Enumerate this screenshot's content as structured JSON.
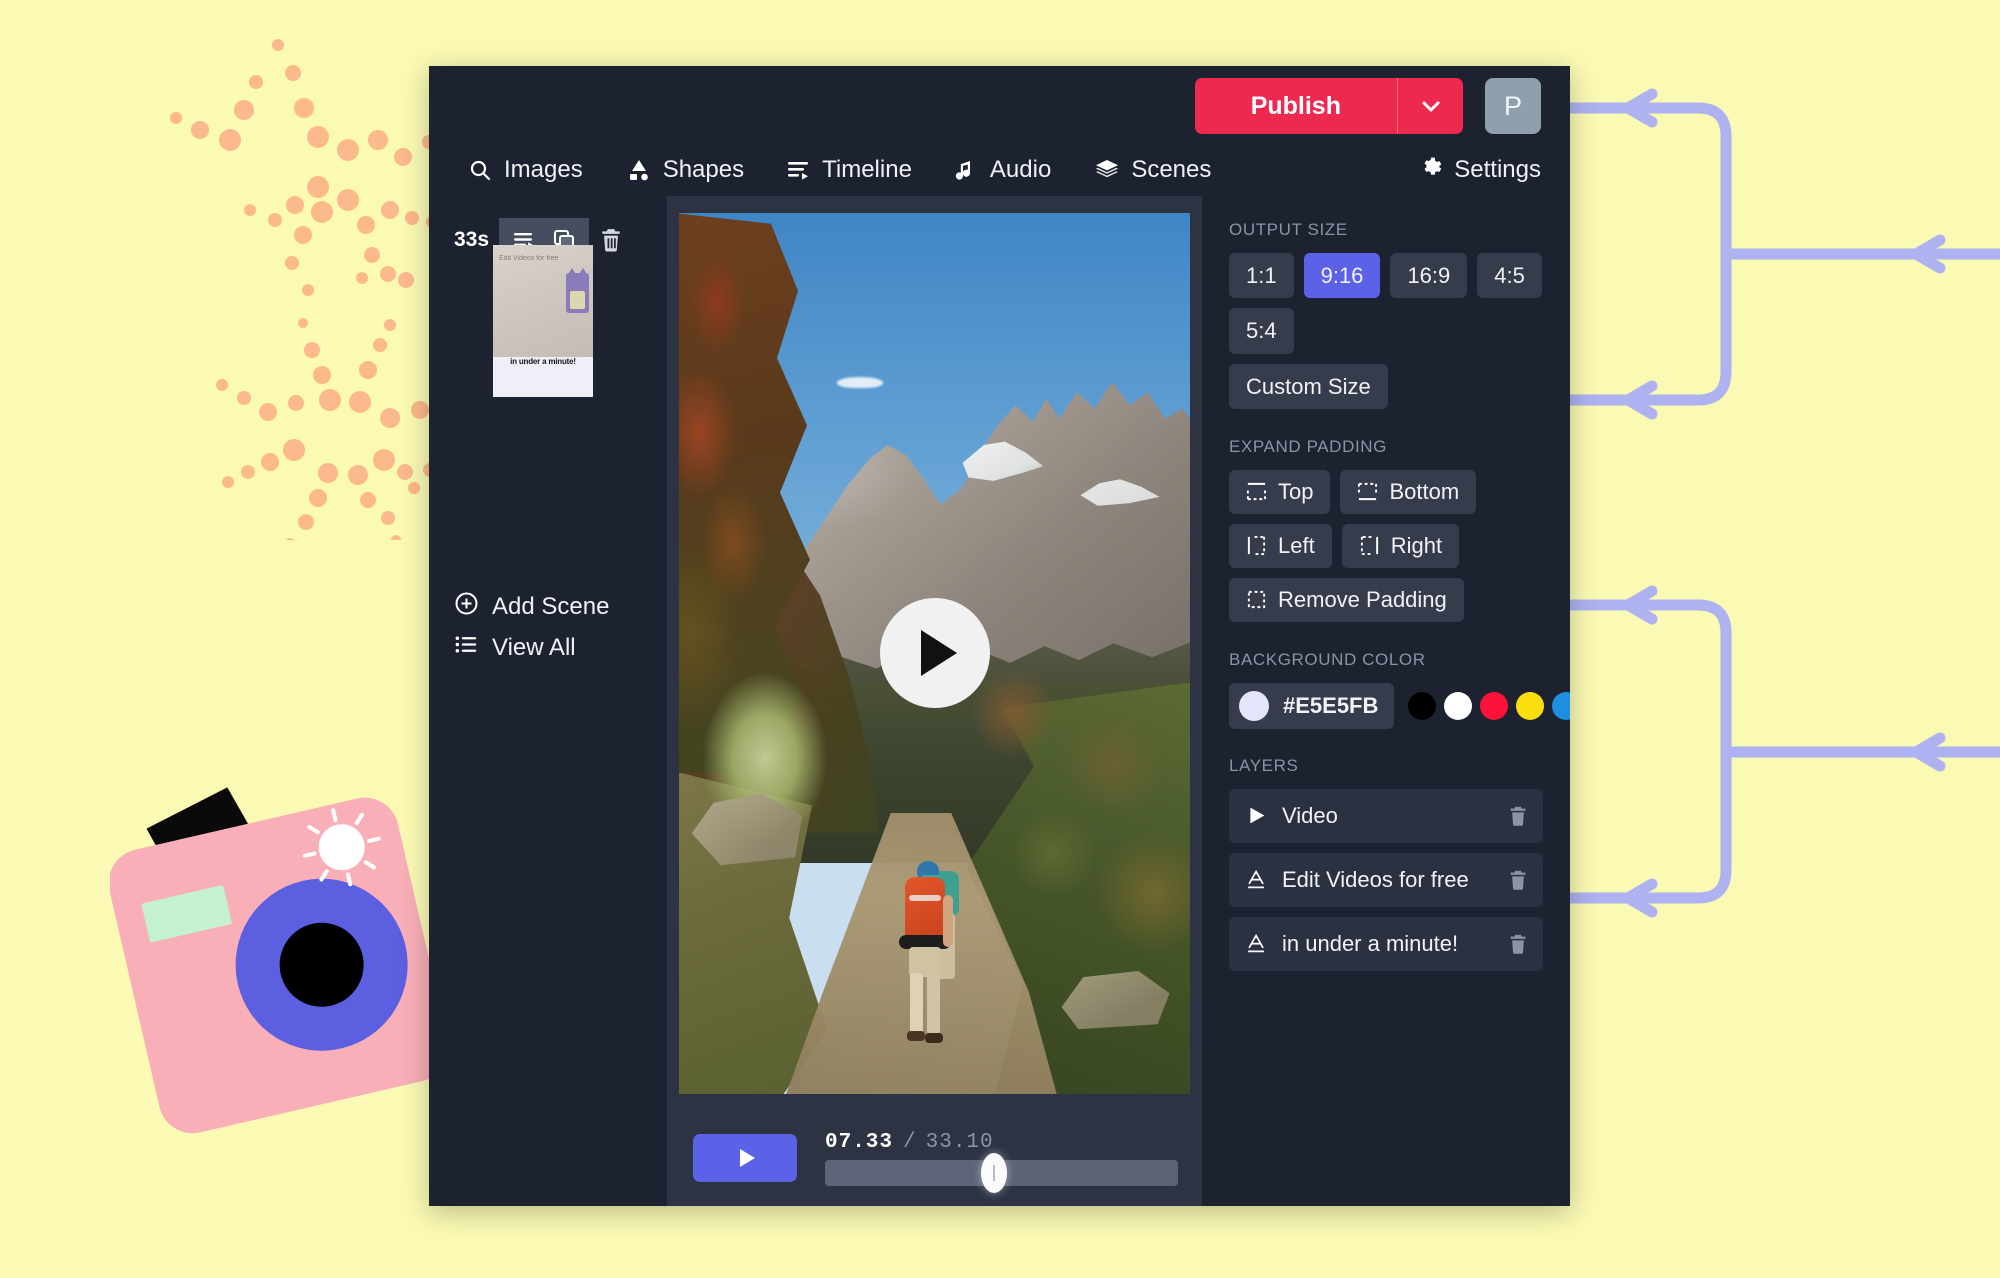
{
  "app": {
    "background_page_color": "#FAFAB4",
    "window_bg": "#1d2230",
    "accent_purple": "#5B62E8",
    "accent_red": "#ED2950",
    "deco_dot_color": "#FCB98B",
    "deco_bracket_color": "#AEB2F0"
  },
  "header": {
    "publish_label": "Publish",
    "publish_caret_icon": "chevron-down-icon",
    "avatar_initial": "P",
    "settings_label": "Settings",
    "settings_icon": "gear-icon",
    "nav": [
      {
        "label": "Images",
        "icon": "search-icon"
      },
      {
        "label": "Shapes",
        "icon": "shapes-icon"
      },
      {
        "label": "Timeline",
        "icon": "timeline-icon"
      },
      {
        "label": "Audio",
        "icon": "music-note-icon"
      },
      {
        "label": "Scenes",
        "icon": "layers-stack-icon"
      }
    ]
  },
  "scene_rail": {
    "duration_label": "33s",
    "tools": [
      {
        "name": "scene-settings-icon"
      },
      {
        "name": "duplicate-scene-icon"
      },
      {
        "name": "delete-scene-icon"
      }
    ],
    "thumbnail": {
      "caption_top": "Edit Videos for free",
      "caption_bottom": "in under a minute!"
    },
    "add_scene_label": "Add Scene",
    "add_scene_icon": "plus-circle-icon",
    "view_all_label": "View All",
    "view_all_icon": "list-icon"
  },
  "preview": {
    "play_overlay_icon": "play-icon"
  },
  "transport": {
    "play_icon": "play-icon",
    "current_time": "07.33",
    "separator": "/",
    "total_time": "33.10",
    "progress_percent": 48
  },
  "right_panel": {
    "output_size": {
      "label": "OUTPUT SIZE",
      "options": [
        "1:1",
        "9:16",
        "16:9",
        "4:5",
        "5:4"
      ],
      "selected": "9:16",
      "custom_label": "Custom Size"
    },
    "expand_padding": {
      "label": "EXPAND PADDING",
      "options": [
        {
          "label": "Top",
          "icon": "pad-top-icon"
        },
        {
          "label": "Bottom",
          "icon": "pad-bottom-icon"
        },
        {
          "label": "Left",
          "icon": "pad-left-icon"
        },
        {
          "label": "Right",
          "icon": "pad-right-icon"
        },
        {
          "label": "Remove Padding",
          "icon": "pad-remove-icon"
        }
      ]
    },
    "background_color": {
      "label": "BACKGROUND COLOR",
      "value": "#E5E5FB",
      "presets": [
        "#000000",
        "#FFFFFF",
        "#FB1239",
        "#FBDE0D",
        "#1C8FE0"
      ]
    },
    "layers": {
      "label": "LAYERS",
      "items": [
        {
          "label": "Video",
          "icon": "play-icon",
          "delete_icon": "trash-icon"
        },
        {
          "label": "Edit Videos for free",
          "icon": "text-a-icon",
          "delete_icon": "trash-icon"
        },
        {
          "label": "in under a minute!",
          "icon": "text-a-icon",
          "delete_icon": "trash-icon"
        }
      ]
    }
  }
}
